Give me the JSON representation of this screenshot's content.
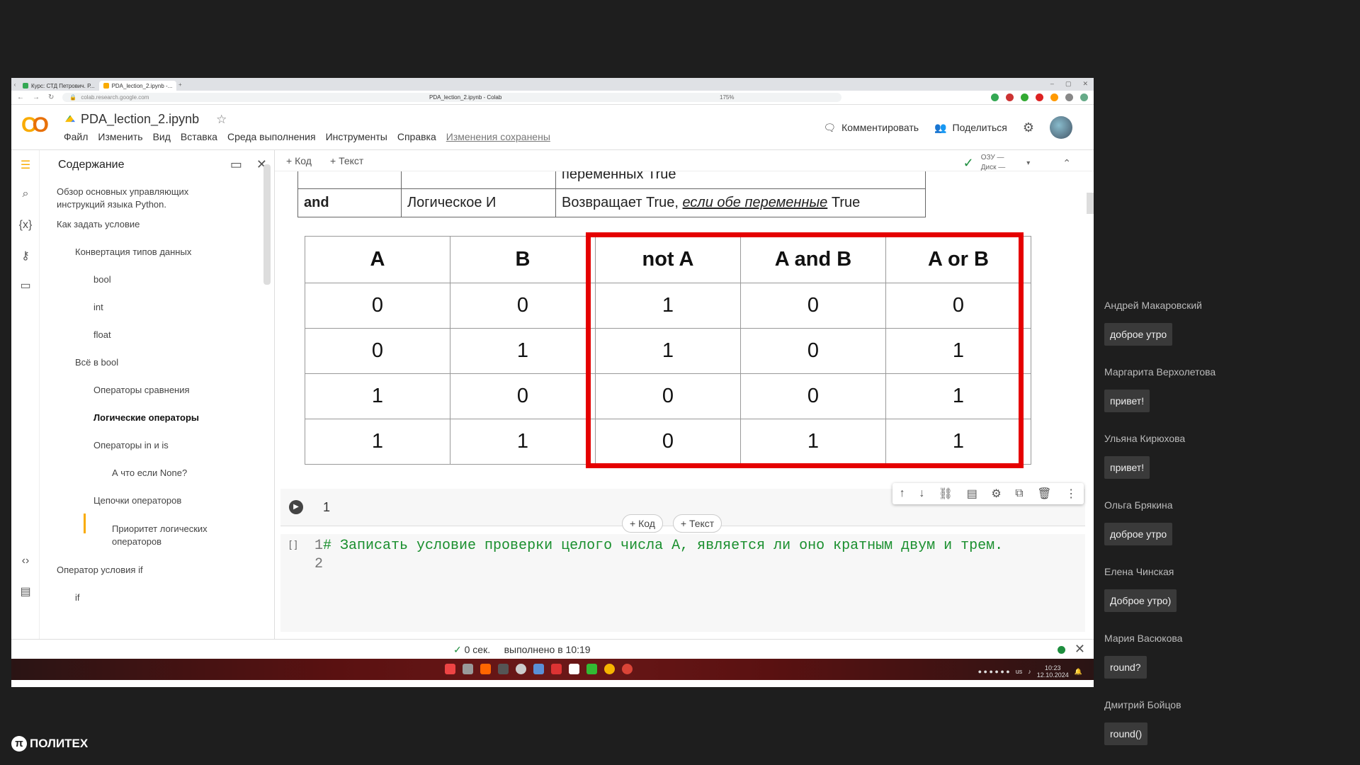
{
  "browser": {
    "tabs": [
      {
        "label": "Курс: СТД Петрович. Р..."
      },
      {
        "label": "PDA_lection_2.ipynb -..."
      }
    ],
    "url": "colab.research.google.com",
    "page_title": "PDA_lection_2.ipynb - Colab",
    "zoom": "175%"
  },
  "colab": {
    "notebook_name": "PDA_lection_2.ipynb",
    "menu": [
      "Файл",
      "Изменить",
      "Вид",
      "Вставка",
      "Среда выполнения",
      "Инструменты",
      "Справка"
    ],
    "saved_status": "Изменения сохранены",
    "comment_label": "Комментировать",
    "share_label": "Поделиться",
    "add_code": "+ Код",
    "add_text": "+ Текст",
    "ram_label": "ОЗУ",
    "disk_label": "Диск"
  },
  "toc": {
    "title": "Содержание",
    "items": [
      {
        "label": "Обзор основных управляющих инструкций языка Python."
      },
      {
        "label": "Как задать условие"
      },
      {
        "label": "Конвертация типов данных"
      },
      {
        "label": "bool"
      },
      {
        "label": "int"
      },
      {
        "label": "float"
      },
      {
        "label": "Всё в bool"
      },
      {
        "label": "Операторы сравнения"
      },
      {
        "label": "Логические операторы"
      },
      {
        "label": "Операторы in и is"
      },
      {
        "label": "А что если None?"
      },
      {
        "label": "Цепочки операторов"
      },
      {
        "label": "Приоритет логических операторов"
      },
      {
        "label": "Оператор условия if"
      },
      {
        "label": "if"
      }
    ]
  },
  "logic_table": {
    "row1_desc": "переменных True",
    "row2": {
      "op": "and",
      "name": "Логическое И",
      "desc_pre": "Возвращает True, ",
      "desc_em": "если обе переменные",
      "desc_post": " True"
    }
  },
  "truth_table": {
    "headers": [
      "A",
      "B",
      "not A",
      "A and B",
      "A or B"
    ],
    "rows": [
      [
        "0",
        "0",
        "1",
        "0",
        "0"
      ],
      [
        "0",
        "1",
        "1",
        "0",
        "1"
      ],
      [
        "1",
        "0",
        "0",
        "0",
        "1"
      ],
      [
        "1",
        "1",
        "0",
        "1",
        "1"
      ]
    ]
  },
  "cells": {
    "cell1_text": "1",
    "cell2_brackets": "[ ]",
    "cell2_line1_no": "1",
    "cell2_line1": "# Записать условие проверки целого числа А, является ли оно кратным двум и трем.",
    "cell2_line2_no": "2"
  },
  "status": {
    "time": "0 сек.",
    "done": "выполнено в 10:19"
  },
  "system": {
    "clock": "10:23",
    "date": "12.10.2024",
    "lang": "us"
  },
  "chat": [
    {
      "name": "Андрей Макаровский",
      "msg": "доброе утро"
    },
    {
      "name": "Маргарита Верхолетова",
      "msg": "привет!"
    },
    {
      "name": "Ульяна Кирюхова",
      "msg": "привет!"
    },
    {
      "name": "Ольга Брякина",
      "msg": "доброе утро"
    },
    {
      "name": "Елена Чинская",
      "msg": "Доброе утро)"
    },
    {
      "name": "Мария Васюкова",
      "msg": "round?"
    },
    {
      "name": "Дмитрий Бойцов",
      "msg": "round()"
    }
  ],
  "brand": {
    "name": "ПОЛИТЕХ",
    "glyph": "π"
  }
}
